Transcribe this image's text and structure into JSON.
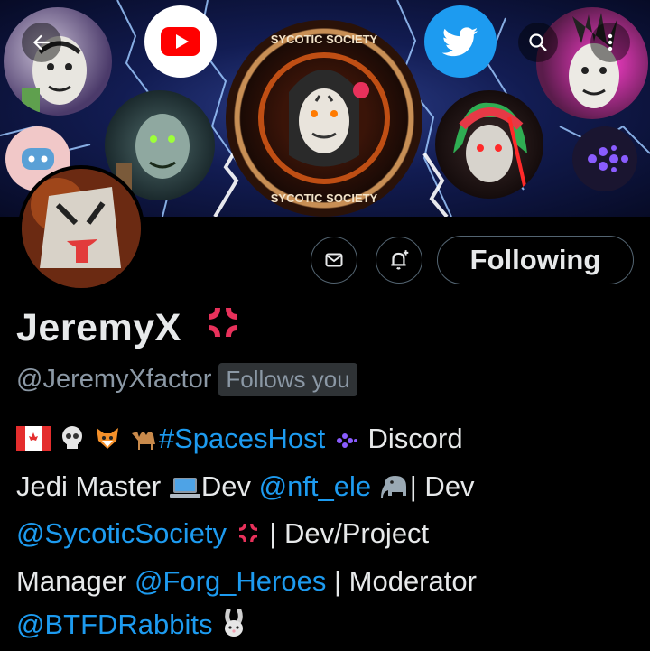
{
  "profile": {
    "display_name": "JeremyX",
    "handle": "@JeremyXfactor",
    "follows_you": "Follows you"
  },
  "actions": {
    "following_label": "Following"
  },
  "banner": {
    "center_logo_top": "SYCOTIC SOCIETY",
    "center_logo_bottom": "SYCOTIC SOCIETY"
  },
  "bio": {
    "hashtag": "#SpacesHost",
    "t_discord": " Discord",
    "t_jedi": "Jedi Master ",
    "t_dev1": "Dev ",
    "mention1": "@nft_ele",
    "t_dev2": "| Dev",
    "mention2": "@SycoticSociety",
    "t_devpm": " | Dev/Project",
    "t_manager": "Manager ",
    "mention3": "@Forg_Heroes",
    "t_moderator": " | Moderator",
    "mention4": "@BTFDRabbits"
  },
  "colors": {
    "background": "#000000",
    "text": "#e7e9ea",
    "secondary_text": "#8b98a5",
    "link": "#1d9bf0",
    "border": "#536471",
    "youtube_red": "#ff0000",
    "twitter_blue": "#1d9bf0"
  }
}
